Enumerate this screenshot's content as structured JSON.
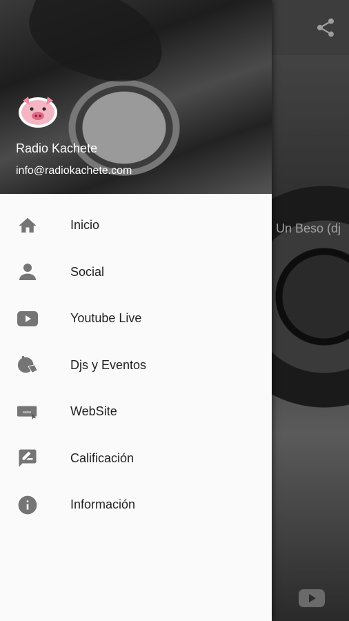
{
  "now_playing": {
    "text": "Un Beso (dj"
  },
  "header": {
    "title": "Radio Kachete",
    "email": "info@radiokachete.com"
  },
  "menu": {
    "items": [
      {
        "label": "Inicio",
        "icon": "home-icon"
      },
      {
        "label": "Social",
        "icon": "person-icon"
      },
      {
        "label": "Youtube Live",
        "icon": "youtube-icon"
      },
      {
        "label": "Djs y Eventos",
        "icon": "djs-events-icon"
      },
      {
        "label": "WebSite",
        "icon": "website-icon"
      },
      {
        "label": "Calificación",
        "icon": "rate-review-icon"
      },
      {
        "label": "Información",
        "icon": "info-icon"
      }
    ]
  },
  "colors": {
    "icon": "#757575",
    "drawer_bg": "#fafafa",
    "text": "#222222"
  }
}
